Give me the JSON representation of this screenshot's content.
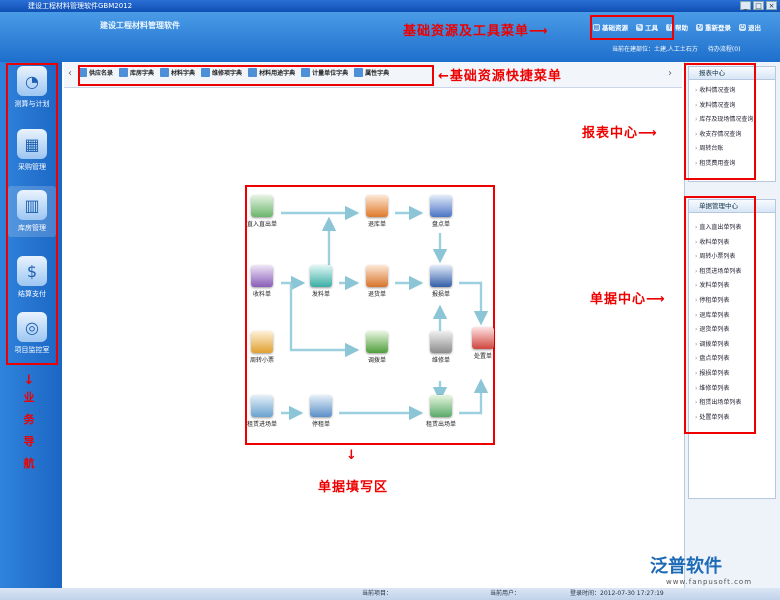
{
  "window": {
    "title": "建设工程材料管理软件GBM2012"
  },
  "header": {
    "app_title": "建设工程材料管理软件",
    "menu": [
      {
        "label": "基础资源",
        "icon": "folder-icon"
      },
      {
        "label": "工具",
        "icon": "tools-icon"
      },
      {
        "label": "帮助",
        "icon": "help-icon"
      },
      {
        "label": "重新登录",
        "icon": "refresh-icon"
      },
      {
        "label": "退出",
        "icon": "exit-icon"
      }
    ],
    "unit_label": "当前在建部位：土建,人工土石方",
    "pending_label": "待办流程(0)"
  },
  "annotations": {
    "base_menu": "基础资源及工具菜单",
    "quick_menu": "基础资源快捷菜单",
    "report_center": "报表中心",
    "doc_center": "单据中心",
    "form_area": "单据填写区",
    "business_nav": [
      "业",
      "务",
      "导",
      "航"
    ]
  },
  "left_nav": [
    {
      "label": "测算与计划",
      "icon": "chart-icon"
    },
    {
      "label": "采购管理",
      "icon": "cart-icon"
    },
    {
      "label": "库房管理",
      "icon": "warehouse-icon"
    },
    {
      "label": "结算支付",
      "icon": "payment-icon"
    },
    {
      "label": "项目监控室",
      "icon": "monitor-icon"
    }
  ],
  "quick_menu": [
    "供应名录",
    "库房字典",
    "材料字典",
    "维修项字典",
    "材料用途字典",
    "计量单位字典",
    "属性字典"
  ],
  "flow": {
    "nodes": {
      "direct": "直入直出单",
      "receive": "收料单",
      "smallticket": "周转小票",
      "rentin": "租赁进场单",
      "issue": "发料单",
      "rentstop": "停租单",
      "returnstore": "退库单",
      "return": "退货单",
      "transfer": "调拨单",
      "stocktake": "盘点单",
      "loss": "报损单",
      "repair": "维修单",
      "rentout": "租赁出场单",
      "dispose": "处置单"
    }
  },
  "report_center": {
    "title": "报表中心",
    "items": [
      "收料情况查询",
      "发料情况查询",
      "库存及现场情况查询",
      "收支存情况查询",
      "周转台账",
      "租赁费用查询"
    ]
  },
  "doc_center": {
    "title": "单据管理中心",
    "items": [
      "直入直出单列表",
      "收料单列表",
      "周转小票列表",
      "租赁进场单列表",
      "发料单列表",
      "停租单列表",
      "退库单列表",
      "退货单列表",
      "调拨单列表",
      "盘点单列表",
      "报损单列表",
      "维修单列表",
      "租赁出场单列表",
      "处置单列表"
    ]
  },
  "status": {
    "project": "当前项目：",
    "user": "当前用户：",
    "login_time": "登录时间：2012-07-30 17:27:19"
  },
  "brand": {
    "name": "泛普软件",
    "url": "www.fanpusoft.com"
  }
}
